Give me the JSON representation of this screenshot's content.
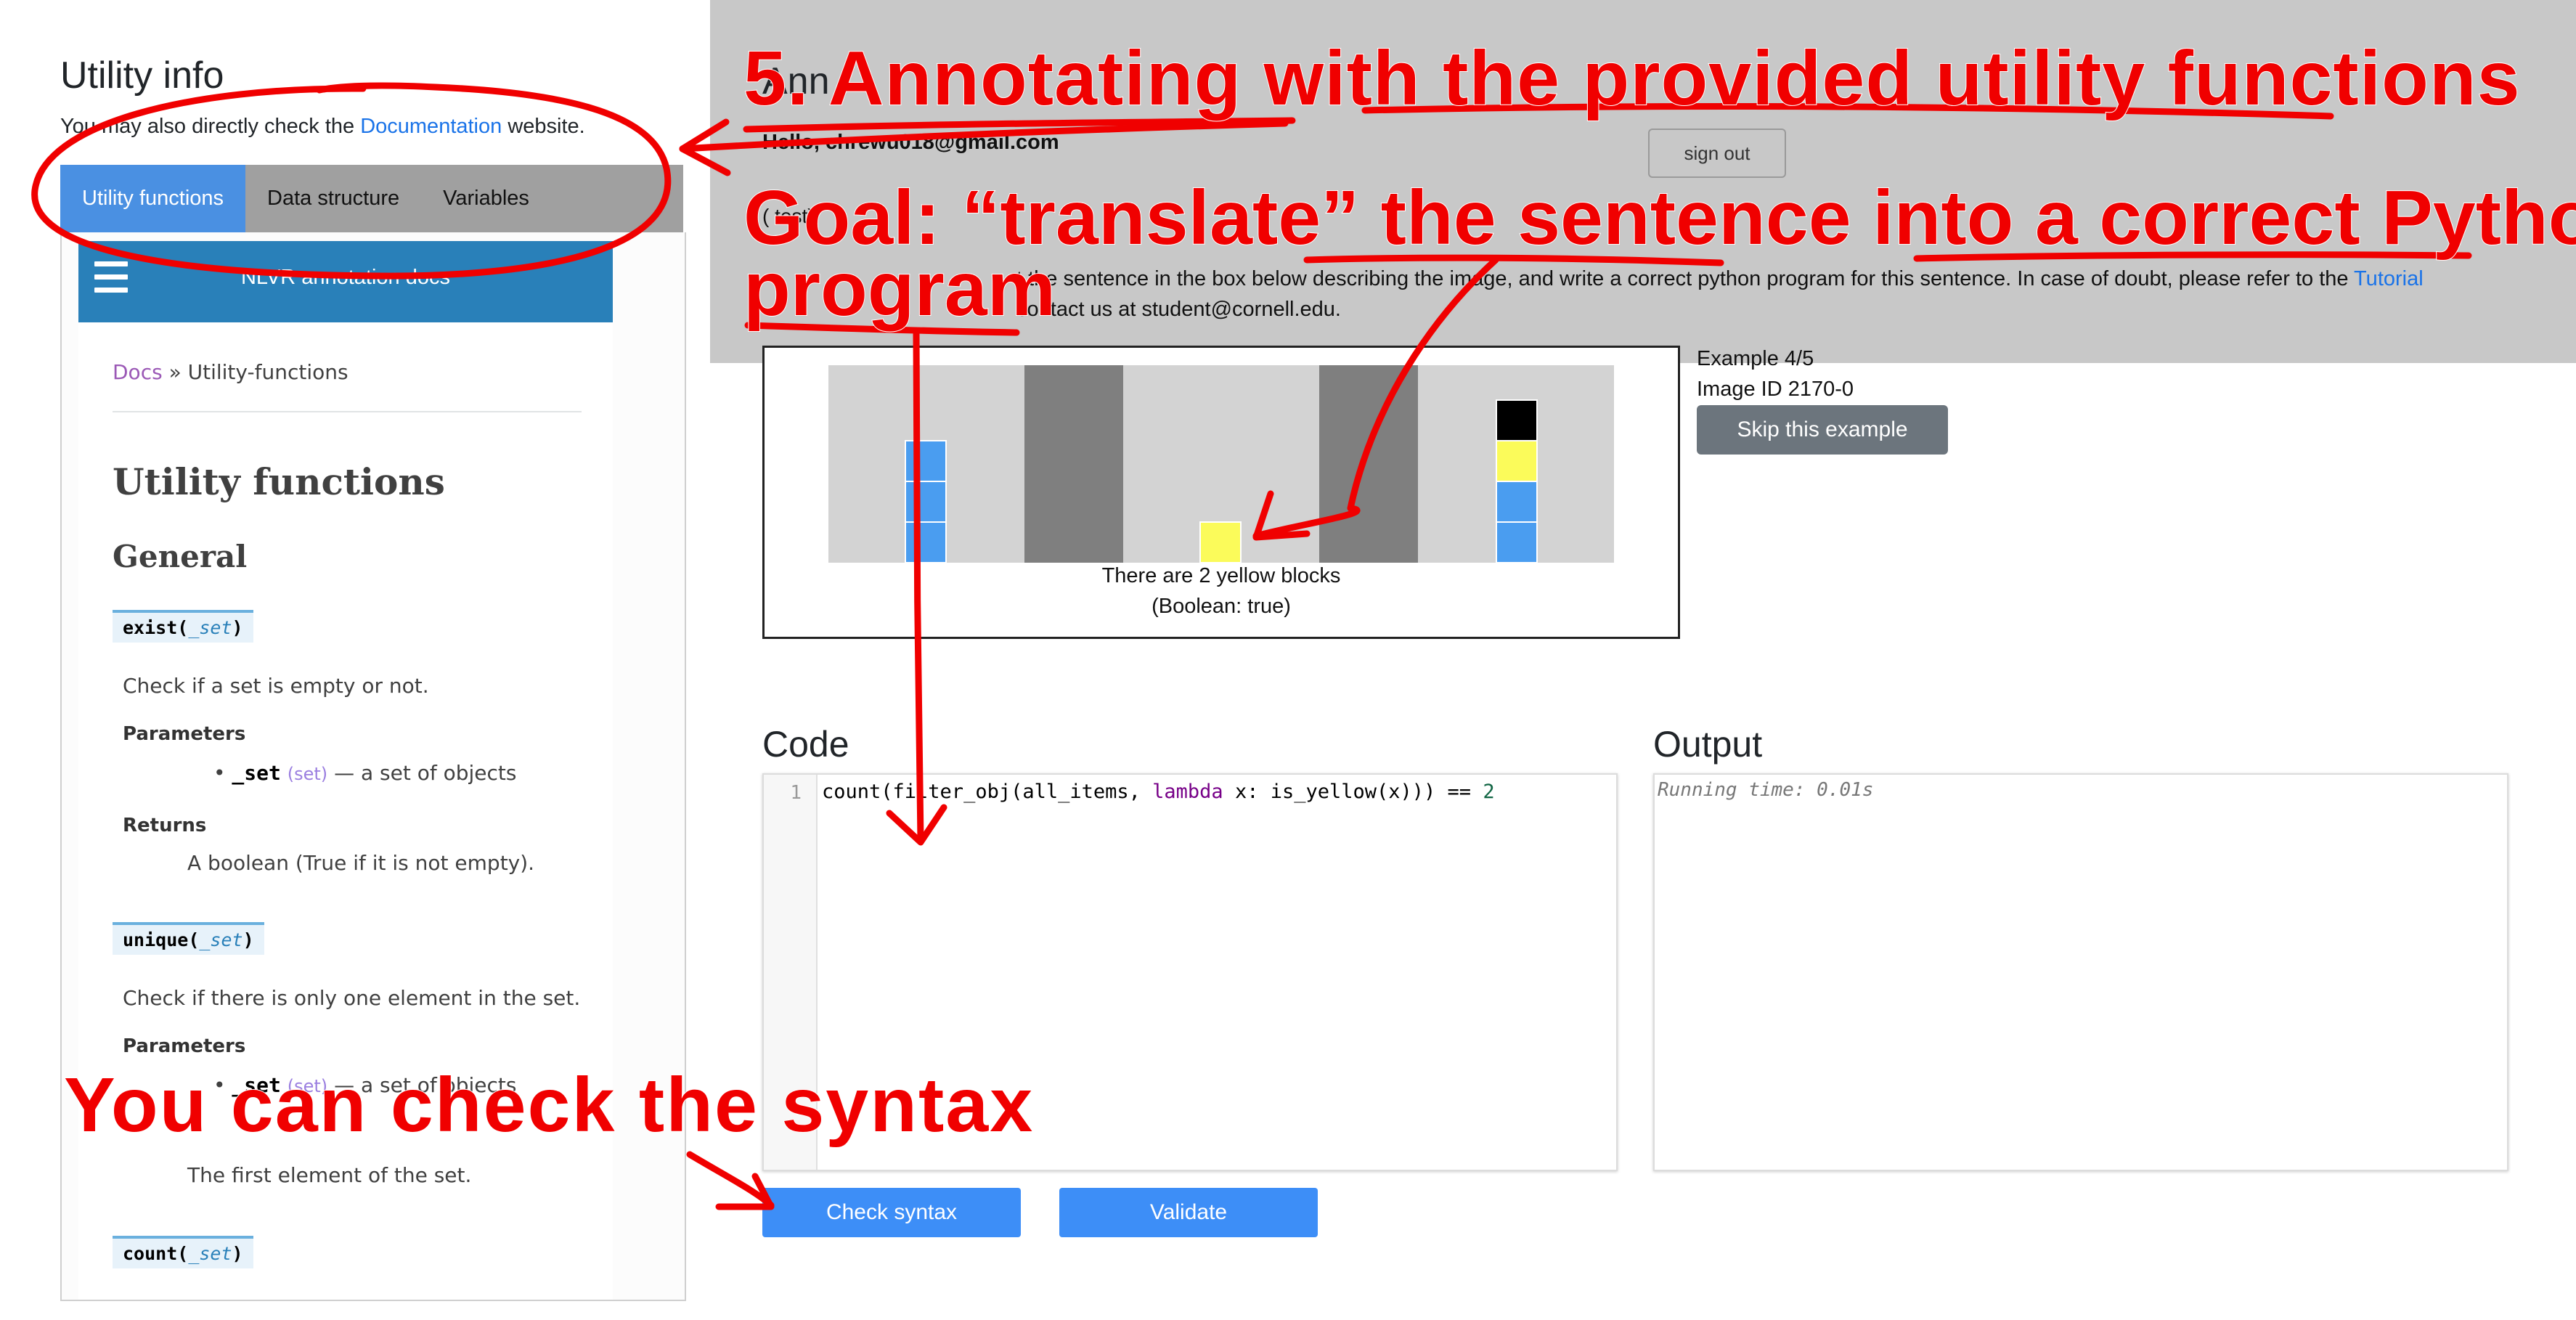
{
  "utility_panel": {
    "title": "Utility info",
    "subtitle_before": "You may also directly check the ",
    "subtitle_link": "Documentation",
    "subtitle_after": " website.",
    "tabs": [
      "Utility functions",
      "Data structure",
      "Variables"
    ],
    "active_tab": "Utility functions",
    "docs_header_title": "NLVR annotation docs",
    "breadcrumb_link": "Docs",
    "breadcrumb_sep": " » ",
    "breadcrumb_current": "Utility-functions",
    "heading": "Utility functions",
    "subheading": "General",
    "functions": [
      {
        "name": "exist",
        "param_sig": "_set",
        "description": "Check if a set is empty or not.",
        "params_label": "Parameters",
        "param_name": "_set",
        "param_type": "(set)",
        "param_desc": " — a set of objects",
        "returns_label": "Returns",
        "returns_desc": "A boolean (True if it is not empty)."
      },
      {
        "name": "unique",
        "param_sig": "_set",
        "description": "Check if there is only one element in the set.",
        "params_label": "Parameters",
        "param_name": "_set",
        "param_type": "(set)",
        "param_desc": " — a set of objects",
        "returns_desc": "The first element of the set."
      },
      {
        "name": "count",
        "param_sig": "_set"
      }
    ]
  },
  "page": {
    "title_partial": "Ann",
    "hello": "Hello, chrewu018@gmail.com",
    "sign_out": "sign out",
    "task_label": "(     test):",
    "instruction_line1": "t the sentence in the box below describing the image, and write a correct python program for this sentence. In case of doubt, please refer to the ",
    "tutorial_link": "Tutorial",
    "instruction_line2": "contact us at student@cornell.edu."
  },
  "example": {
    "sentence": "There are 2 yellow blocks",
    "label": "(Boolean: true)",
    "counter": "Example 4/5",
    "image_id": "Image ID 2170-0",
    "skip_button": "Skip this example"
  },
  "code": {
    "title": "Code",
    "line_number": "1",
    "code_pre": "count(filter_obj(all_items, ",
    "code_kw": "lambda",
    "code_mid": " x: is_yellow(x))) == ",
    "code_num": "2",
    "check_syntax_button": "Check syntax",
    "validate_button": "Validate"
  },
  "output": {
    "title": "Output",
    "text": "Running time: 0.01s"
  },
  "annotations": {
    "title": "5. Annotating with the provided utility functions",
    "goal_line1": "Goal: “translate” the sentence into a correct Python",
    "goal_line2": "program",
    "syntax_note": "You can check the syntax",
    "color": "#f00000"
  },
  "colors": {
    "active_tab": "#4a90e2",
    "docs_header": "#2980b9",
    "button_blue": "#3d8ef7",
    "skip_button": "#6c757d",
    "overlay_gray": "#c8c8c8",
    "block_blue": "#4a9df0",
    "block_yellow": "#fbfb5a",
    "block_black": "#000000",
    "scene_bg": "#d3d3d3",
    "scene_divider": "#7f7f7f"
  }
}
